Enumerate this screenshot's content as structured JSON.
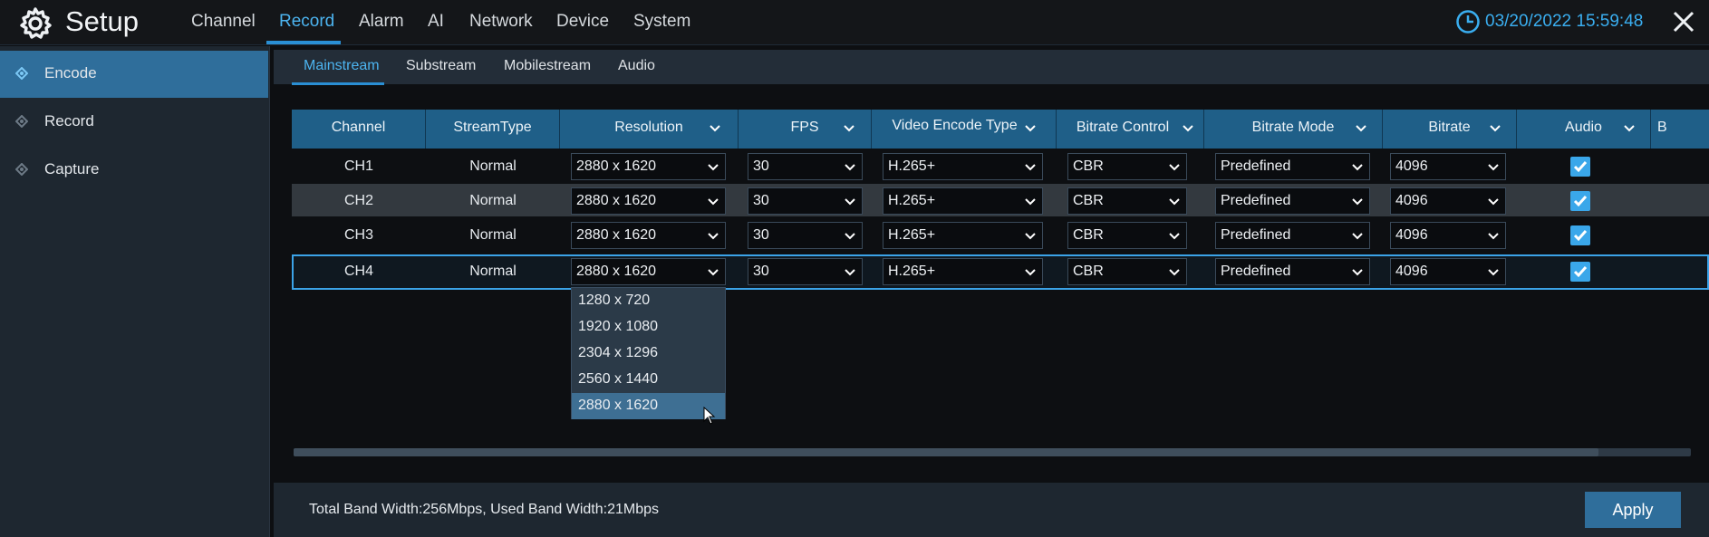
{
  "header": {
    "title": "Setup",
    "nav": [
      "Channel",
      "Record",
      "Alarm",
      "AI",
      "Network",
      "Device",
      "System"
    ],
    "active_nav": "Record",
    "datetime": "03/20/2022 15:59:48"
  },
  "sidebar": {
    "items": [
      {
        "label": "Encode",
        "active": true
      },
      {
        "label": "Record",
        "active": false
      },
      {
        "label": "Capture",
        "active": false
      }
    ]
  },
  "subtabs": {
    "items": [
      "Mainstream",
      "Substream",
      "Mobilestream",
      "Audio"
    ],
    "active": "Mainstream"
  },
  "table": {
    "columns": [
      "Channel",
      "StreamType",
      "Resolution",
      "FPS",
      "Video Encode Type",
      "Bitrate Control",
      "Bitrate Mode",
      "Bitrate",
      "Audio",
      "B"
    ],
    "rows": [
      {
        "channel": "CH1",
        "stream_type": "Normal",
        "resolution": "2880 x 1620",
        "fps": "30",
        "encode": "H.265+",
        "bitrate_control": "CBR",
        "bitrate_mode": "Predefined",
        "bitrate": "4096",
        "audio": true
      },
      {
        "channel": "CH2",
        "stream_type": "Normal",
        "resolution": "2880 x 1620",
        "fps": "30",
        "encode": "H.265+",
        "bitrate_control": "CBR",
        "bitrate_mode": "Predefined",
        "bitrate": "4096",
        "audio": true
      },
      {
        "channel": "CH3",
        "stream_type": "Normal",
        "resolution": "2880 x 1620",
        "fps": "30",
        "encode": "H.265+",
        "bitrate_control": "CBR",
        "bitrate_mode": "Predefined",
        "bitrate": "4096",
        "audio": true
      },
      {
        "channel": "CH4",
        "stream_type": "Normal",
        "resolution": "2880 x 1620",
        "fps": "30",
        "encode": "H.265+",
        "bitrate_control": "CBR",
        "bitrate_mode": "Predefined",
        "bitrate": "4096",
        "audio": true
      }
    ],
    "selected_row": "CH4"
  },
  "resolution_dropdown": {
    "options": [
      "1280 x 720",
      "1920 x 1080",
      "2304 x 1296",
      "2560 x 1440",
      "2880 x 1620"
    ],
    "highlighted": "2880 x 1620"
  },
  "footer": {
    "bandwidth": "Total Band Width:256Mbps, Used Band Width:21Mbps",
    "apply_label": "Apply"
  },
  "colors": {
    "accent": "#3aaef0",
    "header_row": "#1f5f88",
    "selected_sidebar": "#2f6e9b",
    "checkbox": "#3aa7ea"
  },
  "icons": [
    "gear-icon",
    "clock-icon",
    "close-icon",
    "diamond-icon",
    "chevron-down-icon",
    "checkbox-icon",
    "mouse-cursor-icon"
  ]
}
